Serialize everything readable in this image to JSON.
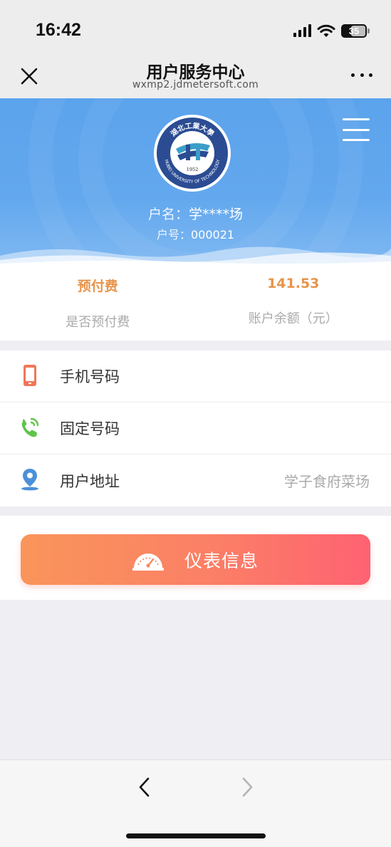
{
  "status_bar": {
    "time": "16:42",
    "battery": "35"
  },
  "nav": {
    "title": "用户服务中心",
    "subtitle": "wxmp2.jdmetersoft.com"
  },
  "header": {
    "logo": {
      "name": "Hubei University of Technology seal",
      "top_text": "湖北工業大學",
      "bottom_text": "HUBEI UNIVERSITY OF TECHNOLOGY",
      "year": "1952"
    },
    "owner_name_label": "户名：",
    "owner_name": "学****场",
    "account_no_label": "户号：",
    "account_no": "000021"
  },
  "summary": [
    {
      "value": "预付费",
      "label": "是否预付费"
    },
    {
      "value": "141.53",
      "label": "账户余额（元）"
    }
  ],
  "info_list": [
    {
      "icon": "phone-icon",
      "label": "手机号码",
      "value": ""
    },
    {
      "icon": "landline-icon",
      "label": "固定号码",
      "value": ""
    },
    {
      "icon": "location-icon",
      "label": "用户地址",
      "value": "学子食府菜场"
    }
  ],
  "meter_button": {
    "label": "仪表信息",
    "icon": "gauge-icon"
  },
  "colors": {
    "accent_orange": "#e8944a",
    "banner_blue": "#5ba3ec",
    "button_start": "#f9955a",
    "button_end": "#fe6272"
  }
}
